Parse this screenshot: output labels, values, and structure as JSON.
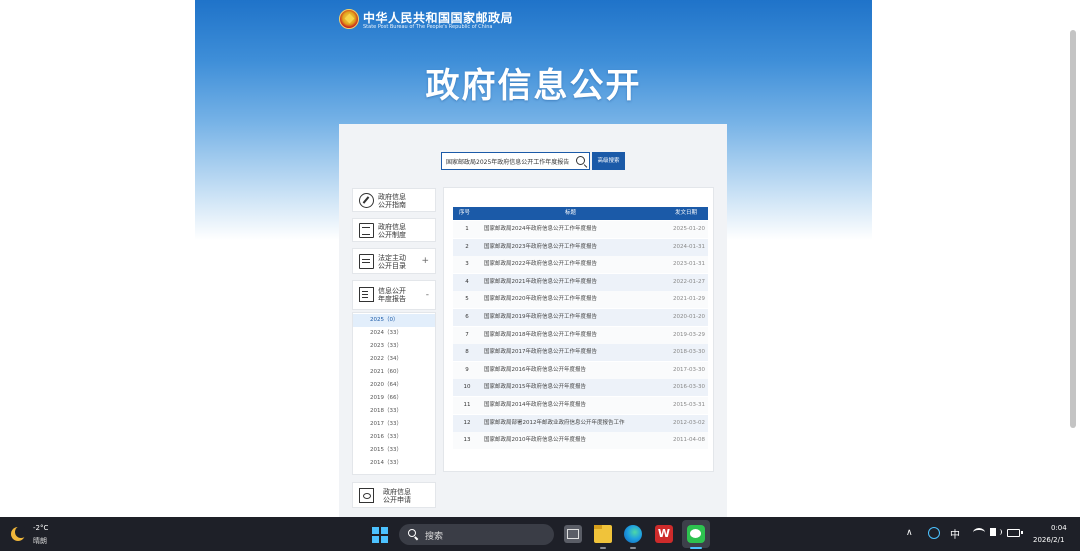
{
  "site": {
    "name_cn": "中华人民共和国国家邮政局",
    "name_en": "State Post Bureau of The People's Republic of China",
    "hero_title": "政府信息公开"
  },
  "search": {
    "value": "国家邮政局2025年政府信息公开工作年度报告",
    "advanced_label": "高级搜索"
  },
  "sidebar": {
    "items": [
      {
        "label": "政府信息\n公开指南",
        "icon": "compass-icon"
      },
      {
        "label": "政府信息\n公开制度",
        "icon": "document-icon"
      },
      {
        "label": "法定主动\n公开目录",
        "icon": "folder-icon",
        "toggle": "+"
      },
      {
        "label": "信息公开\n年度报告",
        "icon": "report-icon",
        "toggle": "-"
      }
    ],
    "years": [
      "2025（0）",
      "2024（33）",
      "2023（33）",
      "2022（34）",
      "2021（60）",
      "2020（64）",
      "2019（66）",
      "2018（33）",
      "2017（33）",
      "2016（33）",
      "2015（33）",
      "2014（33）"
    ],
    "active_year_index": 0,
    "apply": {
      "label": "政府信息\n公开申请",
      "icon": "apply-icon"
    }
  },
  "table": {
    "headers": {
      "no": "序号",
      "title": "标题",
      "date": "发文日期"
    },
    "rows": [
      {
        "no": "1",
        "title": "国家邮政局2024年政府信息公开工作年度报告",
        "date": "2025-01-20"
      },
      {
        "no": "2",
        "title": "国家邮政局2023年政府信息公开工作年度报告",
        "date": "2024-01-31"
      },
      {
        "no": "3",
        "title": "国家邮政局2022年政府信息公开工作年度报告",
        "date": "2023-01-31"
      },
      {
        "no": "4",
        "title": "国家邮政局2021年政府信息公开工作年度报告",
        "date": "2022-01-27"
      },
      {
        "no": "5",
        "title": "国家邮政局2020年政府信息公开工作年度报告",
        "date": "2021-01-29"
      },
      {
        "no": "6",
        "title": "国家邮政局2019年政府信息公开工作年度报告",
        "date": "2020-01-20"
      },
      {
        "no": "7",
        "title": "国家邮政局2018年政府信息公开工作年度报告",
        "date": "2019-03-29"
      },
      {
        "no": "8",
        "title": "国家邮政局2017年政府信息公开工作年度报告",
        "date": "2018-03-30"
      },
      {
        "no": "9",
        "title": "国家邮政局2016年政府信息公开年度报告",
        "date": "2017-03-30"
      },
      {
        "no": "10",
        "title": "国家邮政局2015年政府信息公开年度报告",
        "date": "2016-03-30"
      },
      {
        "no": "11",
        "title": "国家邮政局2014年政府信息公开年度报告",
        "date": "2015-03-31"
      },
      {
        "no": "12",
        "title": "国家邮政局部署2012年邮政业政府信息公开年度报告工作",
        "date": "2012-03-02"
      },
      {
        "no": "13",
        "title": "国家邮政局2010年政府信息公开年度报告",
        "date": "2011-04-08"
      }
    ]
  },
  "taskbar": {
    "temperature": "-2°C",
    "condition": "晴朗",
    "search_placeholder": "搜索",
    "wps_label": "W",
    "ime": "中",
    "time": "0:04",
    "date": "2026/2/1",
    "apps": [
      "task-view-icon",
      "file-explorer-icon",
      "edge-icon",
      "wps-icon",
      "wechat-icon"
    ]
  }
}
